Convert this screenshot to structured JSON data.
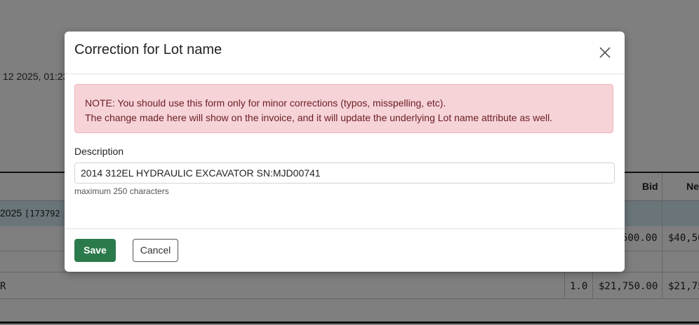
{
  "background": {
    "date_fragment": "12 2025, 01:23",
    "table_headers": [
      "Bid",
      "Ne"
    ],
    "group_row": {
      "text": "2025",
      "code": "[173792"
    },
    "rows": [
      {
        "c1": "",
        "c2": "500.00",
        "c3": "$40,50"
      },
      {
        "lead": "R",
        "c1": "1.0",
        "c2": "$21,750.00",
        "c3": "$21,75"
      }
    ]
  },
  "modal": {
    "title": "Correction for Lot name",
    "close_icon": "close-icon",
    "alert": {
      "line1": "NOTE: You should use this form only for minor corrections (typos, misspelling, etc).",
      "line2": "The change made here will show on the invoice, and it will update the underlying Lot name attribute as well."
    },
    "field": {
      "label": "Description",
      "value": "2014 312EL HYDRAULIC EXCAVATOR SN:MJD00741",
      "help": "maximum 250 characters"
    },
    "buttons": {
      "save": "Save",
      "cancel": "Cancel"
    }
  },
  "colors": {
    "save_button": "#2b7a4b",
    "alert_bg": "#f6d3d7",
    "alert_text": "#6a1d24",
    "backdrop": "rgba(0,0,0,0.5)"
  }
}
